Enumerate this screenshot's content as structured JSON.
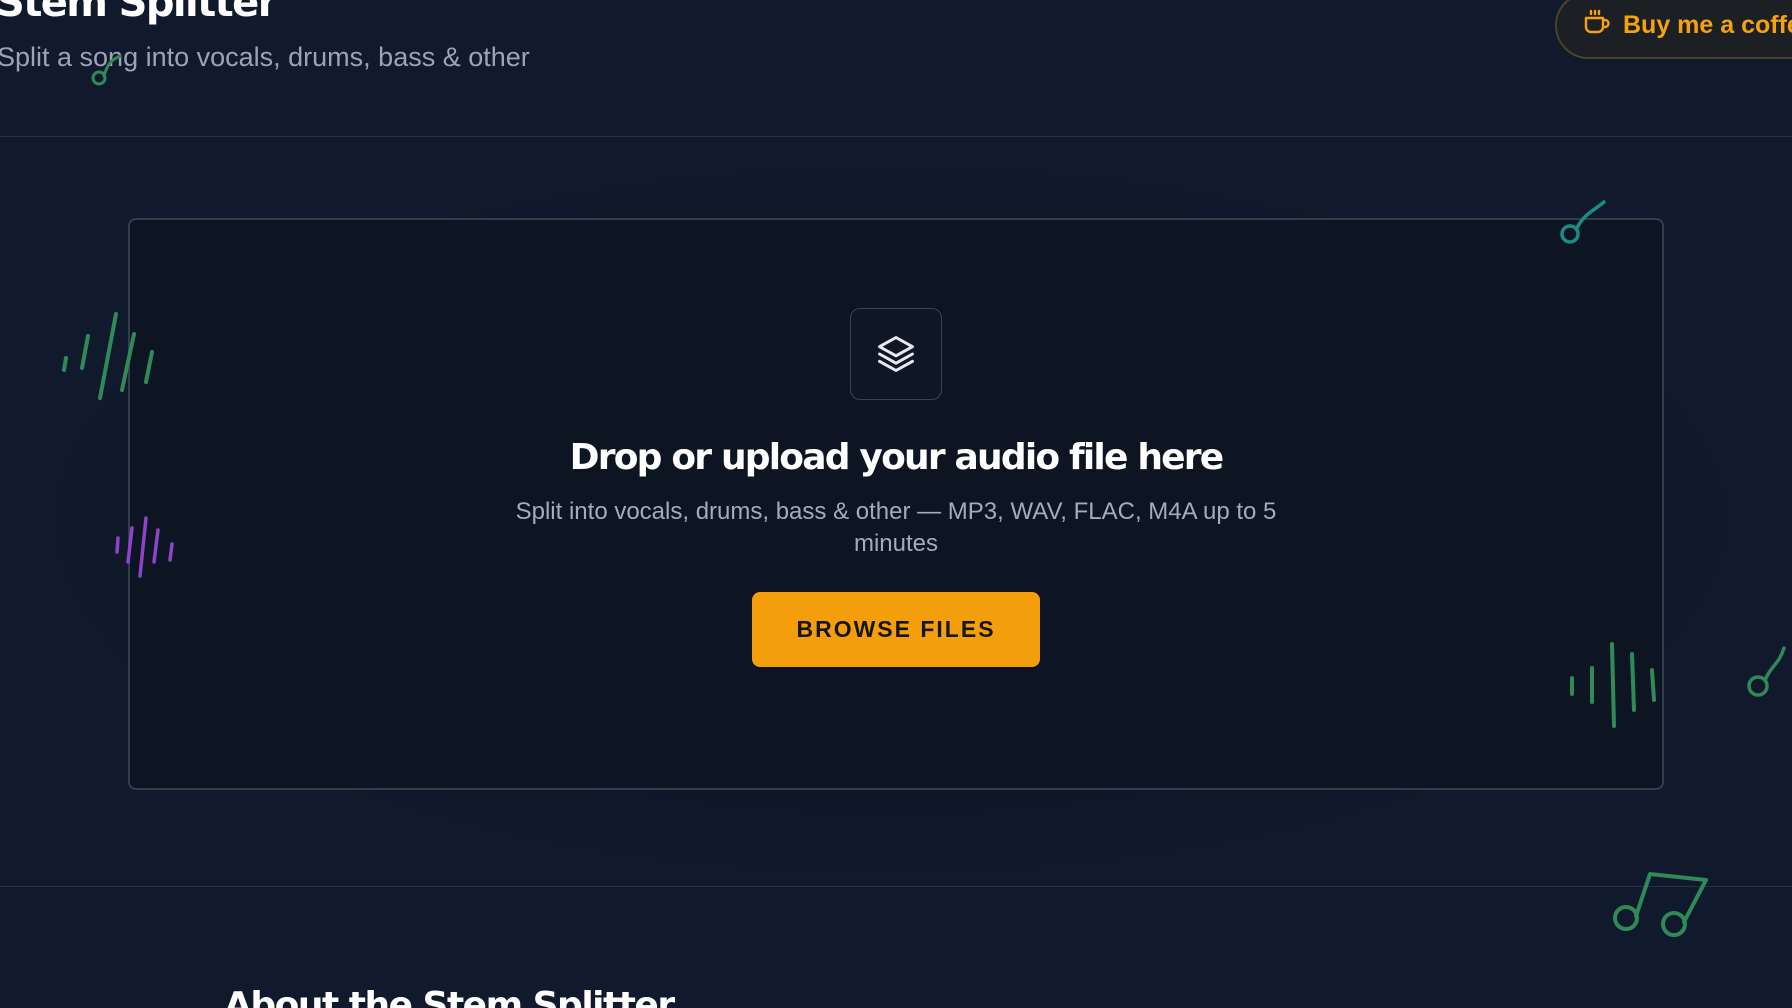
{
  "header": {
    "title": "Stem Splitter",
    "subtitle": "Split a song into vocals, drums, bass & other",
    "coffee_label": "Buy me a coffee"
  },
  "upload": {
    "icon": "layers-icon",
    "title": "Drop or upload your audio file here",
    "description": "Split into vocals, drums, bass & other — MP3, WAV, FLAC, M4A up to 5 minutes",
    "button_label": "BROWSE FILES"
  },
  "about": {
    "title": "About the Stem Splitter"
  },
  "colors": {
    "background": "#111a2c",
    "accent": "#f59e0b",
    "coffee_text": "#f5a20c",
    "deco_green": "#34a853",
    "deco_teal": "#14b8a6",
    "deco_purple": "#a855f7"
  }
}
